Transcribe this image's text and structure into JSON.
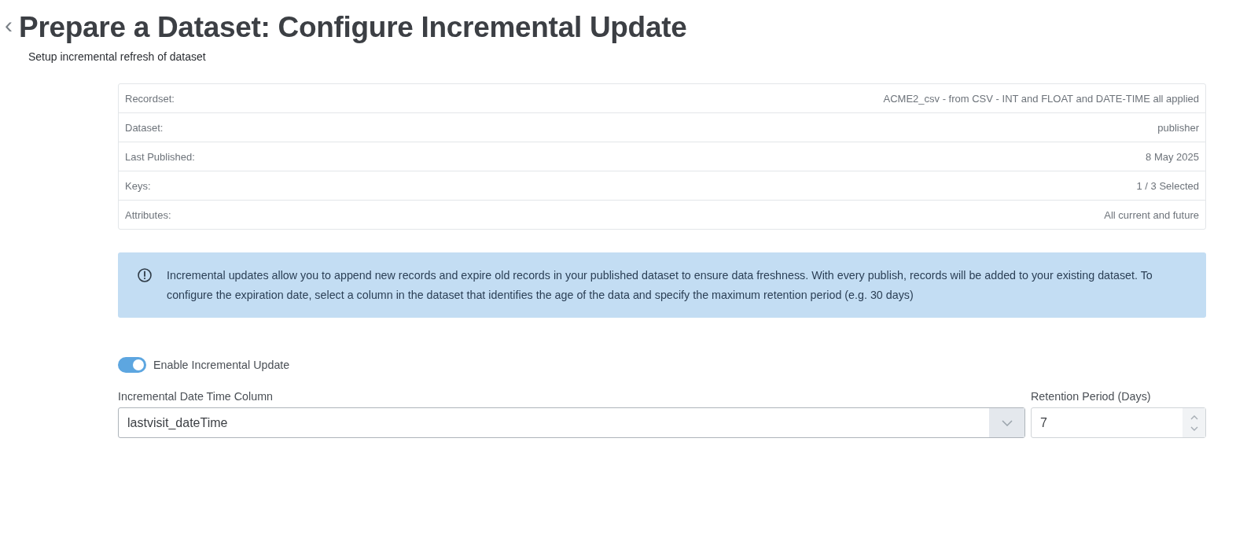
{
  "header": {
    "back": "‹",
    "title": "Prepare a Dataset: Configure Incremental Update",
    "subtitle": "Setup incremental refresh of dataset"
  },
  "summary": [
    {
      "label": "Recordset:",
      "value": "ACME2_csv - from CSV - INT and FLOAT and DATE-TIME all applied"
    },
    {
      "label": "Dataset:",
      "value": "publisher"
    },
    {
      "label": "Last Published:",
      "value": "8 May 2025"
    },
    {
      "label": "Keys:",
      "value": "1 / 3 Selected"
    },
    {
      "label": "Attributes:",
      "value": "All current and future"
    }
  ],
  "info": "Incremental updates allow you to append new records and expire old records in your published dataset to ensure data freshness. With every publish, records will be added to your existing dataset. To configure the expiration date, select a column in the dataset that identifies the age of the data and specify the maximum retention period (e.g. 30 days)",
  "toggle": {
    "label": "Enable Incremental Update",
    "on": true
  },
  "date_column": {
    "label": "Incremental Date Time Column",
    "value": "lastvisit_dateTime"
  },
  "retention": {
    "label": "Retention Period (Days)",
    "value": "7"
  }
}
